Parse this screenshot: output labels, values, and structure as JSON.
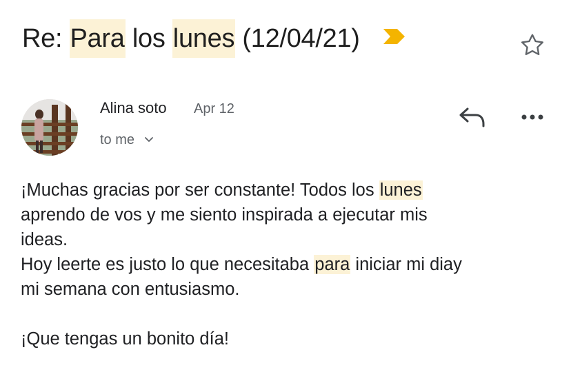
{
  "email": {
    "subject_prefix": "Re:",
    "subject_w1": "Para",
    "subject_w2": "los",
    "subject_w3": "lunes",
    "subject_w4": "(12/04/21)",
    "sender_name": "Alina soto",
    "date": "Apr 12",
    "recipient": "to me",
    "body": {
      "l1_a": "¡Muchas gracias por ser constante! Todos los ",
      "l1_hl": "lunes",
      "l2": "aprendo de vos y me siento inspirada a ejecutar mis",
      "l3": "ideas.",
      "l4_a": "Hoy leerte es justo lo que necesitaba ",
      "l4_hl": "para",
      "l4_b": " iniciar mi diay",
      "l5": "mi semana con entusiasmo.",
      "closing": "¡Que tengas un bonito día!"
    }
  },
  "icons": {
    "label": "label-important-icon",
    "star": "star-outline-icon",
    "reply": "reply-icon",
    "more": "more-horizontal-icon",
    "chevron": "chevron-down-icon"
  },
  "colors": {
    "highlight": "#fcf2d6",
    "important_marker": "#f4b400",
    "text_primary": "#202124",
    "text_secondary": "#5f6368"
  }
}
